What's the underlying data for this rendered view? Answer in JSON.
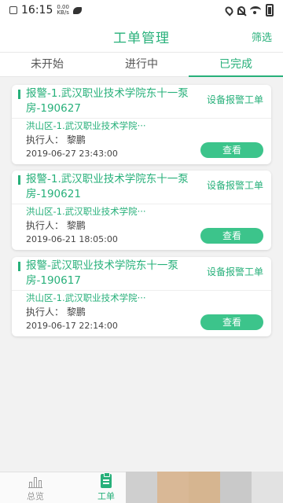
{
  "status_bar": {
    "time": "16:15",
    "speed_value": "0.00",
    "speed_unit": "KB/s"
  },
  "header": {
    "title": "工单管理",
    "filter_label": "筛选"
  },
  "tabs": [
    {
      "label": "未开始",
      "active": false
    },
    {
      "label": "进行中",
      "active": false
    },
    {
      "label": "已完成",
      "active": true
    }
  ],
  "orders": [
    {
      "title": "报警-1.武汉职业技术学院东十一泵房-190627",
      "type": "设备报警工单",
      "address": "洪山区-1.武汉职业技术学院···",
      "executor": "执行人：  黎鹏",
      "time": "2019-06-27 23:43:00",
      "action": "查看"
    },
    {
      "title": "报警-1.武汉职业技术学院东十一泵房-190621",
      "type": "设备报警工单",
      "address": "洪山区-1.武汉职业技术学院···",
      "executor": "执行人：  黎鹏",
      "time": "2019-06-21 18:05:00",
      "action": "查看"
    },
    {
      "title": "报警-武汉职业技术学院东十一泵房-190617",
      "type": "设备报警工单",
      "address": "洪山区-1.武汉职业技术学院···",
      "executor": "执行人：  黎鹏",
      "time": "2019-06-17 22:14:00",
      "action": "查看"
    }
  ],
  "bottom_nav": [
    {
      "label": "总览",
      "icon": "bar-chart-icon",
      "active": false
    },
    {
      "label": "工单",
      "icon": "clipboard-icon",
      "active": true
    }
  ],
  "colors": {
    "accent": "#27b07a",
    "button": "#3cc48b",
    "background": "#f2f2f2"
  }
}
